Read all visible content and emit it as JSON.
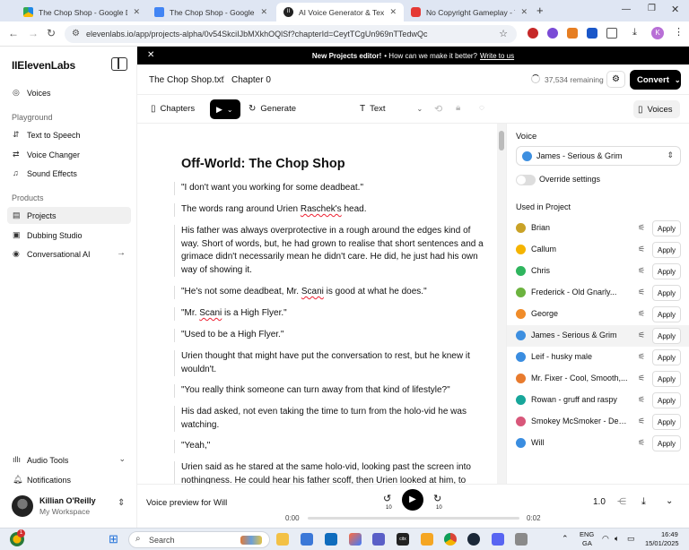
{
  "browser": {
    "tabs": [
      {
        "title": "The Chop Shop - Google Drive",
        "color": "#1e88e5"
      },
      {
        "title": "The Chop Shop - Google Docs",
        "color": "#4285f4"
      },
      {
        "title": "AI Voice Generator & Text to Sp",
        "color": "#222222"
      },
      {
        "title": "No Copyright Gameplay - YouT",
        "color": "#e53935"
      }
    ],
    "new_tab": "+",
    "url": "elevenlabs.io/app/projects-alpha/0v54SkciIJbMXkhOQlSf?chapterId=CeytTCgUn969nTTedwQc",
    "profile_initial": "K"
  },
  "sidebar": {
    "brand": "IIElevenLabs",
    "top_item": "Voices",
    "playground_heading": "Playground",
    "playground_items": [
      "Text to Speech",
      "Voice Changer",
      "Sound Effects"
    ],
    "products_heading": "Products",
    "products_items": [
      "Projects",
      "Dubbing Studio",
      "Conversational AI"
    ],
    "bottom_items": [
      "Audio Tools",
      "Notifications"
    ],
    "user_name": "Killian O'Reilly",
    "user_workspace": "My Workspace"
  },
  "banner": {
    "bold": "New Projects editor!",
    "text": "• How can we make it better?",
    "link": "Write to us"
  },
  "header": {
    "file": "The Chop Shop.txt",
    "sep": "/",
    "chapter": "Chapter 0",
    "remaining": "37,534 remaining",
    "convert": "Convert"
  },
  "toolbar": {
    "chapters": "Chapters",
    "generate": "Generate",
    "text": "Text",
    "voices": "Voices"
  },
  "editor": {
    "title": "Off-World: The Chop Shop",
    "paragraphs": [
      "\"I don't want you working for some deadbeat.\"",
      "The words rang around Urien Raschek's head.",
      "His father was always overprotective in a rough around the edges kind of way. Short of words, but, he had grown to realise that short sentences and a grimace didn't necessarily mean he didn't care. He did, he just had his own way of showing it.",
      "\"He's not some deadbeat, Mr. Scani is good at what he does.\"",
      "\"Mr. Scani is a High Flyer.\"",
      "\"Used to be a High Flyer.\"",
      "Urien thought that might have put the conversation to rest, but he knew it wouldn't.",
      "\"You really think someone can turn away from that kind of lifestyle?\"",
      "His dad asked, not even taking the time to turn from the holo-vid he was watching.",
      "\"Yeah,\"",
      "Urien said as he stared at the same holo-vid, looking past the screen into nothingness. He could hear his father scoff, then Urien looked at him, to"
    ]
  },
  "panel": {
    "voice_label": "Voice",
    "selected_voice": "James - Serious & Grim",
    "override": "Override settings",
    "used_label": "Used in Project",
    "apply": "Apply",
    "voices": [
      {
        "name": "Brian",
        "color": "#c9a227"
      },
      {
        "name": "Callum",
        "color": "#f5b400"
      },
      {
        "name": "Chris",
        "color": "#2fb55e"
      },
      {
        "name": "Frederick - Old Gnarly...",
        "color": "#6cb33f"
      },
      {
        "name": "George",
        "color": "#f08c2a"
      },
      {
        "name": "James - Serious & Grim",
        "color": "#3d8fe0"
      },
      {
        "name": "Leif - husky male",
        "color": "#3a8de0"
      },
      {
        "name": "Mr. Fixer - Cool, Smooth,...",
        "color": "#e87b2e"
      },
      {
        "name": "Rowan - gruff and raspy",
        "color": "#17a69a"
      },
      {
        "name": "Smokey McSmoker - Dee...",
        "color": "#d8577a"
      },
      {
        "name": "Will",
        "color": "#3a8de0"
      }
    ]
  },
  "player": {
    "label": "Voice preview for Will",
    "back": "10",
    "fwd": "10",
    "speed": "1.0",
    "time_start": "0:00",
    "time_end": "0:02",
    "progress": 0
  },
  "taskbar": {
    "search": "Search",
    "lang1": "ENG",
    "lang2": "GA",
    "time": "16:49",
    "date": "15/01/2025",
    "badge": "1"
  }
}
